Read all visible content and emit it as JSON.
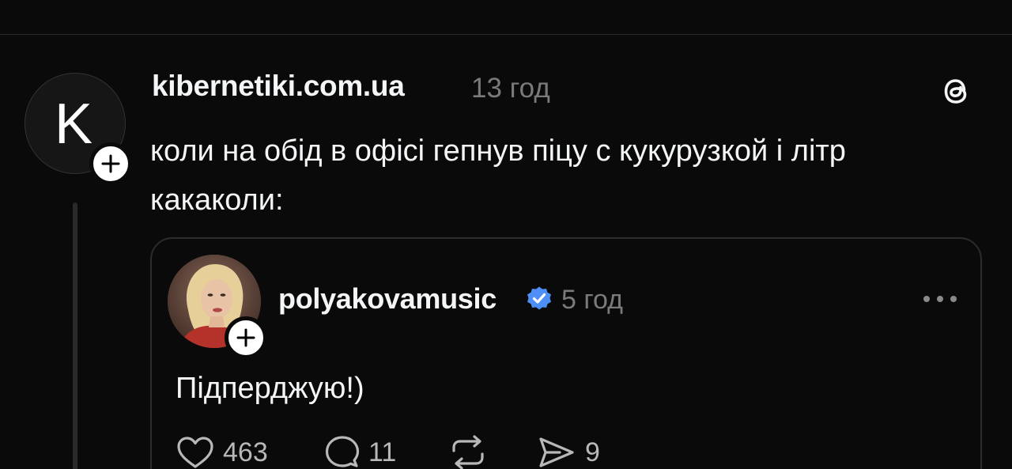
{
  "post": {
    "avatar_letter": "K",
    "username": "kibernetiki.com.ua",
    "time": "13 год",
    "text": "коли на обід в офісі гепнув піцу с кукурузкой і літр какаколи:",
    "app_icon": "threads-logo-icon"
  },
  "quoted_post": {
    "username": "polyakovamusic",
    "verified": true,
    "time": "5 год",
    "text": "Підперджую!)",
    "actions": {
      "likes": "463",
      "replies": "11",
      "reposts": "",
      "shares": "9"
    }
  },
  "colors": {
    "background": "#0a0a0a",
    "text": "#f3f5f7",
    "muted": "#7a7a7a",
    "verified": "#0095f6",
    "border": "#2c2c2c"
  }
}
